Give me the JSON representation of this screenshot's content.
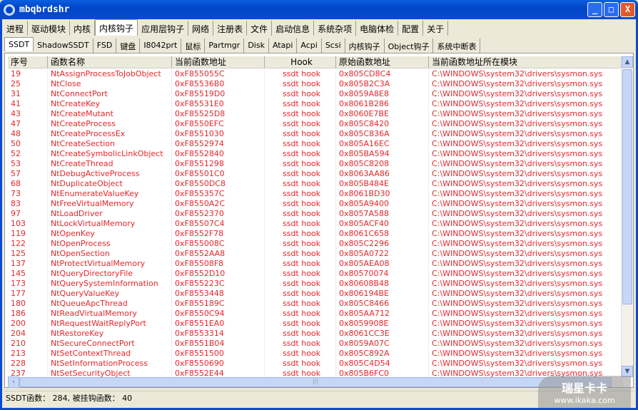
{
  "window": {
    "title": "mbqbrdshr",
    "min": "_",
    "max": "□",
    "close": "X"
  },
  "main_tabs": [
    "进程",
    "驱动模块",
    "内核",
    "内核钩子",
    "应用层钩子",
    "网络",
    "注册表",
    "文件",
    "启动信息",
    "系统杂项",
    "电脑体检",
    "配置",
    "关于"
  ],
  "main_selected": 3,
  "sub_tabs": [
    "SSDT",
    "ShadowSSDT",
    "FSD",
    "键盘",
    "I8042prt",
    "鼠标",
    "Partmgr",
    "Disk",
    "Atapi",
    "Acpi",
    "Scsi",
    "内核钩子",
    "Object钩子",
    "系统中断表"
  ],
  "sub_selected": 0,
  "columns": [
    "序号",
    "函数名称",
    "当前函数地址",
    "Hook",
    "原始函数地址",
    "当前函数地址所在模块"
  ],
  "rows": [
    [
      "19",
      "NtAssignProcessToJobObject",
      "0xF855055C",
      "ssdt hook",
      "0x805CD8C4",
      "C:\\WINDOWS\\system32\\drivers\\sysmon.sys"
    ],
    [
      "25",
      "NtClose",
      "0xF85536B0",
      "ssdt hook",
      "0x805B2C3A",
      "C:\\WINDOWS\\system32\\drivers\\sysmon.sys"
    ],
    [
      "31",
      "NtConnectPort",
      "0xF85519D0",
      "ssdt hook",
      "0x8059A8E8",
      "C:\\WINDOWS\\system32\\drivers\\sysmon.sys"
    ],
    [
      "41",
      "NtCreateKey",
      "0xF85531E0",
      "ssdt hook",
      "0x8061B286",
      "C:\\WINDOWS\\system32\\drivers\\sysmon.sys"
    ],
    [
      "43",
      "NtCreateMutant",
      "0xF85525D8",
      "ssdt hook",
      "0x8060E7BE",
      "C:\\WINDOWS\\system32\\drivers\\sysmon.sys"
    ],
    [
      "47",
      "NtCreateProcess",
      "0xF8550EFC",
      "ssdt hook",
      "0x805C8420",
      "C:\\WINDOWS\\system32\\drivers\\sysmon.sys"
    ],
    [
      "48",
      "NtCreateProcessEx",
      "0xF8551030",
      "ssdt hook",
      "0x805C836A",
      "C:\\WINDOWS\\system32\\drivers\\sysmon.sys"
    ],
    [
      "50",
      "NtCreateSection",
      "0xF8552974",
      "ssdt hook",
      "0x805A16EC",
      "C:\\WINDOWS\\system32\\drivers\\sysmon.sys"
    ],
    [
      "52",
      "NtCreateSymbolicLinkObject",
      "0xF8552840",
      "ssdt hook",
      "0x805BA594",
      "C:\\WINDOWS\\system32\\drivers\\sysmon.sys"
    ],
    [
      "53",
      "NtCreateThread",
      "0xF8551298",
      "ssdt hook",
      "0x805C8208",
      "C:\\WINDOWS\\system32\\drivers\\sysmon.sys"
    ],
    [
      "57",
      "NtDebugActiveProcess",
      "0xF85501C0",
      "ssdt hook",
      "0x8063AA86",
      "C:\\WINDOWS\\system32\\drivers\\sysmon.sys"
    ],
    [
      "68",
      "NtDuplicateObject",
      "0xF8550DC8",
      "ssdt hook",
      "0x805B484E",
      "C:\\WINDOWS\\system32\\drivers\\sysmon.sys"
    ],
    [
      "73",
      "NtEnumerateValueKey",
      "0xF855357C",
      "ssdt hook",
      "0x8061BD30",
      "C:\\WINDOWS\\system32\\drivers\\sysmon.sys"
    ],
    [
      "83",
      "NtFreeVirtualMemory",
      "0xF8550A2C",
      "ssdt hook",
      "0x805A9400",
      "C:\\WINDOWS\\system32\\drivers\\sysmon.sys"
    ],
    [
      "97",
      "NtLoadDriver",
      "0xF8552370",
      "ssdt hook",
      "0x8057A588",
      "C:\\WINDOWS\\system32\\drivers\\sysmon.sys"
    ],
    [
      "103",
      "NtLockVirtualMemory",
      "0xF85507C4",
      "ssdt hook",
      "0x805ACF40",
      "C:\\WINDOWS\\system32\\drivers\\sysmon.sys"
    ],
    [
      "119",
      "NtOpenKey",
      "0xF8552F78",
      "ssdt hook",
      "0x8061C658",
      "C:\\WINDOWS\\system32\\drivers\\sysmon.sys"
    ],
    [
      "122",
      "NtOpenProcess",
      "0xF855008C",
      "ssdt hook",
      "0x805C2296",
      "C:\\WINDOWS\\system32\\drivers\\sysmon.sys"
    ],
    [
      "125",
      "NtOpenSection",
      "0xF8552AA8",
      "ssdt hook",
      "0x805A0722",
      "C:\\WINDOWS\\system32\\drivers\\sysmon.sys"
    ],
    [
      "137",
      "NtProtectVirtualMemory",
      "0xF85508F8",
      "ssdt hook",
      "0x805AEA08",
      "C:\\WINDOWS\\system32\\drivers\\sysmon.sys"
    ],
    [
      "145",
      "NtQueryDirectoryFile",
      "0xF8552D10",
      "ssdt hook",
      "0x80570074",
      "C:\\WINDOWS\\system32\\drivers\\sysmon.sys"
    ],
    [
      "173",
      "NtQuerySystemInformation",
      "0xF855223C",
      "ssdt hook",
      "0x80608B48",
      "C:\\WINDOWS\\system32\\drivers\\sysmon.sys"
    ],
    [
      "177",
      "NtQueryValueKey",
      "0xF8553448",
      "ssdt hook",
      "0x806194BE",
      "C:\\WINDOWS\\system32\\drivers\\sysmon.sys"
    ],
    [
      "180",
      "NtQueueApcThread",
      "0xF855189C",
      "ssdt hook",
      "0x805C8466",
      "C:\\WINDOWS\\system32\\drivers\\sysmon.sys"
    ],
    [
      "186",
      "NtReadVirtualMemory",
      "0xF8550C94",
      "ssdt hook",
      "0x805AA712",
      "C:\\WINDOWS\\system32\\drivers\\sysmon.sys"
    ],
    [
      "200",
      "NtRequestWaitReplyPort",
      "0xF8551EA0",
      "ssdt hook",
      "0x8059908E",
      "C:\\WINDOWS\\system32\\drivers\\sysmon.sys"
    ],
    [
      "204",
      "NtRestoreKey",
      "0xF8553314",
      "ssdt hook",
      "0x8061CC3E",
      "C:\\WINDOWS\\system32\\drivers\\sysmon.sys"
    ],
    [
      "210",
      "NtSecureConnectPort",
      "0xF8551B04",
      "ssdt hook",
      "0x8059A07C",
      "C:\\WINDOWS\\system32\\drivers\\sysmon.sys"
    ],
    [
      "213",
      "NtSetContextThread",
      "0xF8551500",
      "ssdt hook",
      "0x805C892A",
      "C:\\WINDOWS\\system32\\drivers\\sysmon.sys"
    ],
    [
      "228",
      "NtSetInformationProcess",
      "0xF8550690",
      "ssdt hook",
      "0x805C4D54",
      "C:\\WINDOWS\\system32\\drivers\\sysmon.sys"
    ],
    [
      "237",
      "NtSetSecurityObject",
      "0xF8552E44",
      "ssdt hook",
      "0x805B6FC0",
      "C:\\WINDOWS\\system32\\drivers\\sysmon.sys"
    ]
  ],
  "status": "SSDT函数： 284, 被挂钩函数： 40",
  "watermark": {
    "name": "瑞星卡卡",
    "url": "www.ikaka.com"
  },
  "colors": {
    "hooked_text": "#e8252a",
    "title_bar": "#0a4bd0"
  }
}
